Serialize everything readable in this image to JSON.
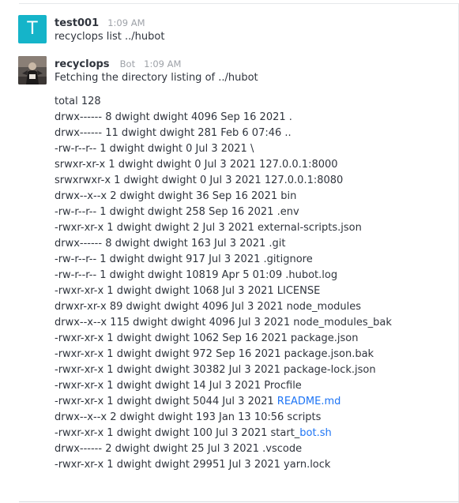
{
  "messages": [
    {
      "avatar_letter": "T",
      "avatar_color": "#15b4c9",
      "user": "test001",
      "time": "1:09 AM",
      "text": "recyclops list ../hubot"
    },
    {
      "user": "recyclops",
      "role": "Bot",
      "time": "1:09 AM",
      "text": "Fetching the directory listing of ../hubot",
      "listing": [
        {
          "text": "total 128"
        },
        {
          "text": "drwx------ 8 dwight dwight 4096 Sep 16 2021 ."
        },
        {
          "text": "drwx------ 11 dwight dwight 281 Feb 6 07:46 .."
        },
        {
          "text": "-rw-r--r-- 1 dwight dwight 0 Jul 3 2021 \\"
        },
        {
          "text": "srwxr-xr-x 1 dwight dwight 0 Jul 3 2021 127.0.0.1:8000"
        },
        {
          "text": "srwxrwxr-x 1 dwight dwight 0 Jul 3 2021 127.0.0.1:8080"
        },
        {
          "text": "drwx--x--x 2 dwight dwight 36 Sep 16 2021 bin"
        },
        {
          "text": "-rw-r--r-- 1 dwight dwight 258 Sep 16 2021 .env"
        },
        {
          "text": "-rwxr-xr-x 1 dwight dwight 2 Jul 3 2021 external-scripts.json"
        },
        {
          "text": "drwx------ 8 dwight dwight 163 Jul 3 2021 .git"
        },
        {
          "text": "-rw-r--r-- 1 dwight dwight 917 Jul 3 2021 .gitignore"
        },
        {
          "text": "-rw-r--r-- 1 dwight dwight 10819 Apr 5 01:09 .hubot.log"
        },
        {
          "text": "-rwxr-xr-x 1 dwight dwight 1068 Jul 3 2021 LICENSE"
        },
        {
          "text": "drwxr-xr-x 89 dwight dwight 4096 Jul 3 2021 node_modules"
        },
        {
          "text": "drwx--x--x 115 dwight dwight 4096 Jul 3 2021 node_modules_bak"
        },
        {
          "text": "-rwxr-xr-x 1 dwight dwight 1062 Sep 16 2021 package.json"
        },
        {
          "text": "-rwxr-xr-x 1 dwight dwight 972 Sep 16 2021 package.json.bak"
        },
        {
          "text": "-rwxr-xr-x 1 dwight dwight 30382 Jul 3 2021 package-lock.json"
        },
        {
          "text": "-rwxr-xr-x 1 dwight dwight 14 Jul 3 2021 Procfile"
        },
        {
          "prefix": "-rwxr-xr-x 1 dwight dwight 5044 Jul 3 2021 ",
          "link": "README.md"
        },
        {
          "text": "drwx--x--x 2 dwight dwight 193 Jan 13 10:56 scripts"
        },
        {
          "prefix": "-rwxr-xr-x 1 dwight dwight 100 Jul 3 2021 start_",
          "link": "bot.sh"
        },
        {
          "text": "drwx------ 2 dwight dwight 25 Jul 3 2021 .vscode"
        },
        {
          "text": "-rwxr-xr-x 1 dwight dwight 29951 Jul 3 2021 yarn.lock"
        }
      ]
    }
  ]
}
